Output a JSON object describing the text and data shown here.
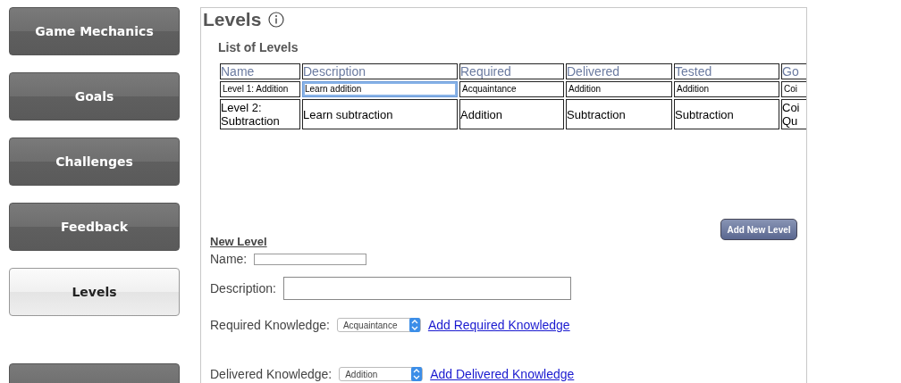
{
  "sidebar": {
    "items": [
      {
        "label": "Game Mechanics",
        "selected": false
      },
      {
        "label": "Goals",
        "selected": false
      },
      {
        "label": "Challenges",
        "selected": false
      },
      {
        "label": "Feedback",
        "selected": false
      },
      {
        "label": "Levels",
        "selected": true
      },
      {
        "selected": false
      }
    ]
  },
  "page": {
    "title": "Levels"
  },
  "list": {
    "title": "List of Levels",
    "columns": [
      "Name",
      "Description",
      "Required",
      "Delivered",
      "Tested",
      "Go"
    ],
    "rows": [
      {
        "kind": "edit",
        "cells": [
          {
            "text": "Level 1: Addition",
            "focused": false
          },
          {
            "text": "Learn addition",
            "focused": true
          },
          {
            "text": "Acquaintance",
            "focused": false
          },
          {
            "text": "Addition",
            "focused": false
          },
          {
            "text": "Addition",
            "focused": false
          },
          {
            "text": "Coi",
            "focused": false
          }
        ]
      },
      {
        "kind": "text",
        "cells": [
          "Level 2: Subtraction",
          "Learn subtraction",
          "Addition",
          "Subtraction",
          "Subtraction",
          "Coi Qu"
        ]
      }
    ]
  },
  "add_button": "Add New Level",
  "form": {
    "title": "New Level",
    "name": {
      "label": "Name:"
    },
    "description": {
      "label": "Description:"
    },
    "knowledge": [
      {
        "label": "Required Knowledge:",
        "value": "Acquaintance",
        "link": "Add Required Knowledge"
      },
      {
        "label": "Delivered Knowledge:",
        "value": "Addition",
        "link": "Add Delivered Knowledge"
      }
    ]
  }
}
